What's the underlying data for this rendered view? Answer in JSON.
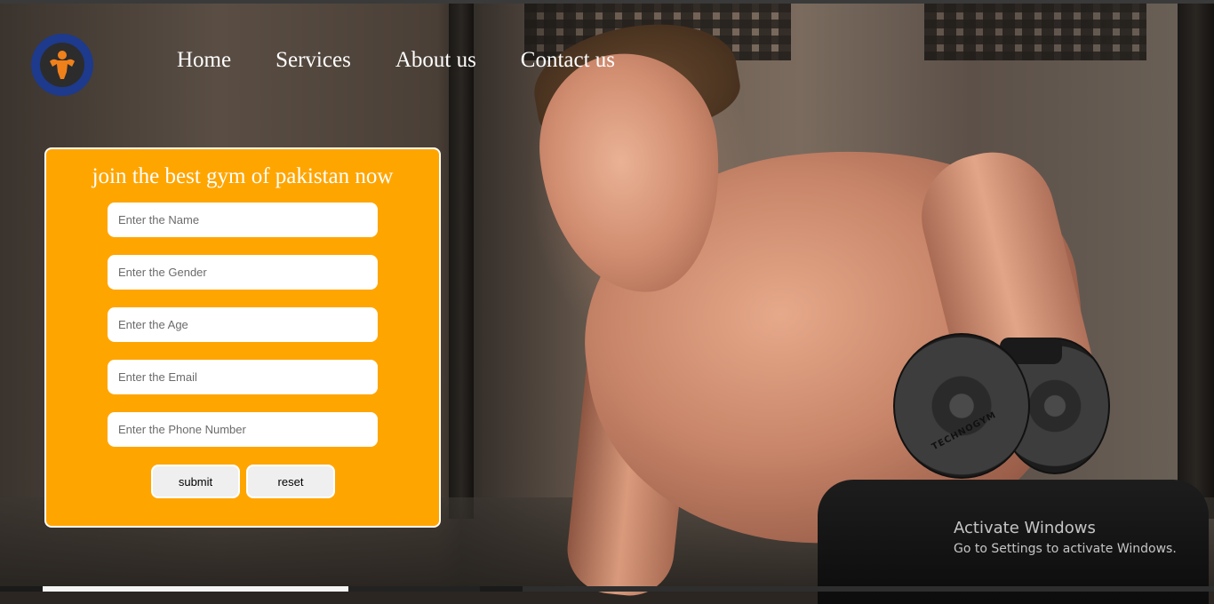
{
  "brand": {
    "logo_icon": "bodybuilder-logo-icon",
    "logo_ring_color": "#1d3a8c",
    "logo_figure_color": "#f0801a"
  },
  "nav": {
    "items": [
      {
        "label": "Home"
      },
      {
        "label": "Services"
      },
      {
        "label": "About us"
      },
      {
        "label": "Contact us"
      }
    ]
  },
  "form": {
    "title": "join the best gym of pakistan now",
    "accent_color": "#ffa500",
    "fields": [
      {
        "placeholder": "Enter the Name",
        "value": ""
      },
      {
        "placeholder": "Enter the Gender",
        "value": ""
      },
      {
        "placeholder": "Enter the Age",
        "value": ""
      },
      {
        "placeholder": "Enter the Email",
        "value": ""
      },
      {
        "placeholder": "Enter the Phone Number",
        "value": ""
      }
    ],
    "submit_label": "submit",
    "reset_label": "reset"
  },
  "hero": {
    "dumbbell_text": "TECHNOGYM"
  },
  "watermark": {
    "title": "Activate Windows",
    "subtitle": "Go to Settings to activate Windows."
  }
}
